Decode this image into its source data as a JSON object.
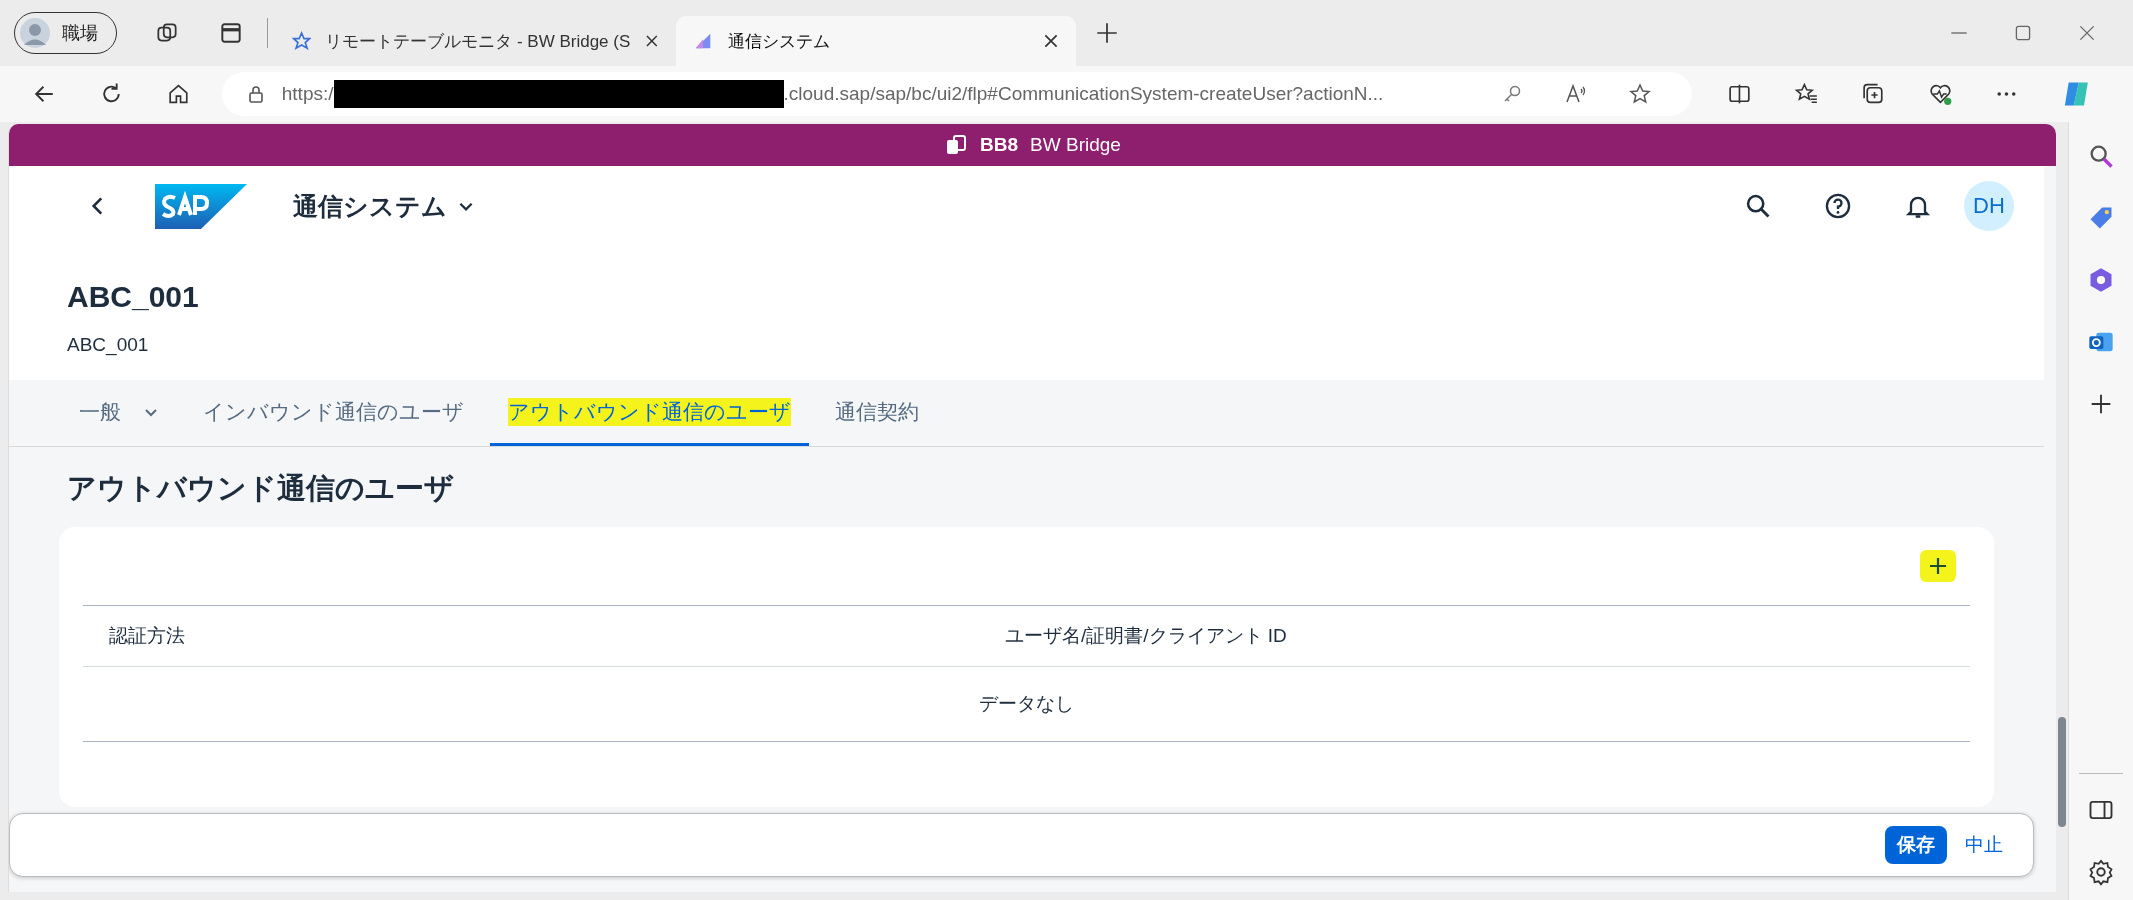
{
  "browser": {
    "profile": {
      "label": "職場"
    },
    "tabs": [
      {
        "title": "リモートテーブルモニタ - BW Bridge (S",
        "selected": false
      },
      {
        "title": "通信システム",
        "selected": true
      }
    ],
    "address": {
      "url_start": "https:/",
      "redacted": true,
      "url_end": ".cloud.sap/sap/bc/ui2/flp#CommunicationSystem-createUser?actionN..."
    }
  },
  "system_bar": {
    "system_id": "BB8",
    "system_name": "BW Bridge"
  },
  "shell": {
    "app_title": "通信システム",
    "avatar": "DH"
  },
  "object": {
    "title": "ABC_001",
    "subtitle": "ABC_001"
  },
  "sections": [
    {
      "label": "一般",
      "has_menu": true,
      "selected": false,
      "highlighted": false
    },
    {
      "label": "インバウンド通信のユーザ",
      "has_menu": false,
      "selected": false,
      "highlighted": false
    },
    {
      "label": "アウトバウンド通信のユーザ",
      "has_menu": false,
      "selected": true,
      "highlighted": true
    },
    {
      "label": "通信契約",
      "has_menu": false,
      "selected": false,
      "highlighted": false
    }
  ],
  "section_title": "アウトバウンド通信のユーザ",
  "table": {
    "add_highlighted": true,
    "columns": [
      "認証方法",
      "ユーザ名/証明書/クライアント ID"
    ],
    "empty_text": "データなし"
  },
  "footer": {
    "buttons": [
      {
        "label": "保存",
        "kind": "emphasized"
      },
      {
        "label": "中止",
        "kind": "transparent"
      }
    ]
  }
}
